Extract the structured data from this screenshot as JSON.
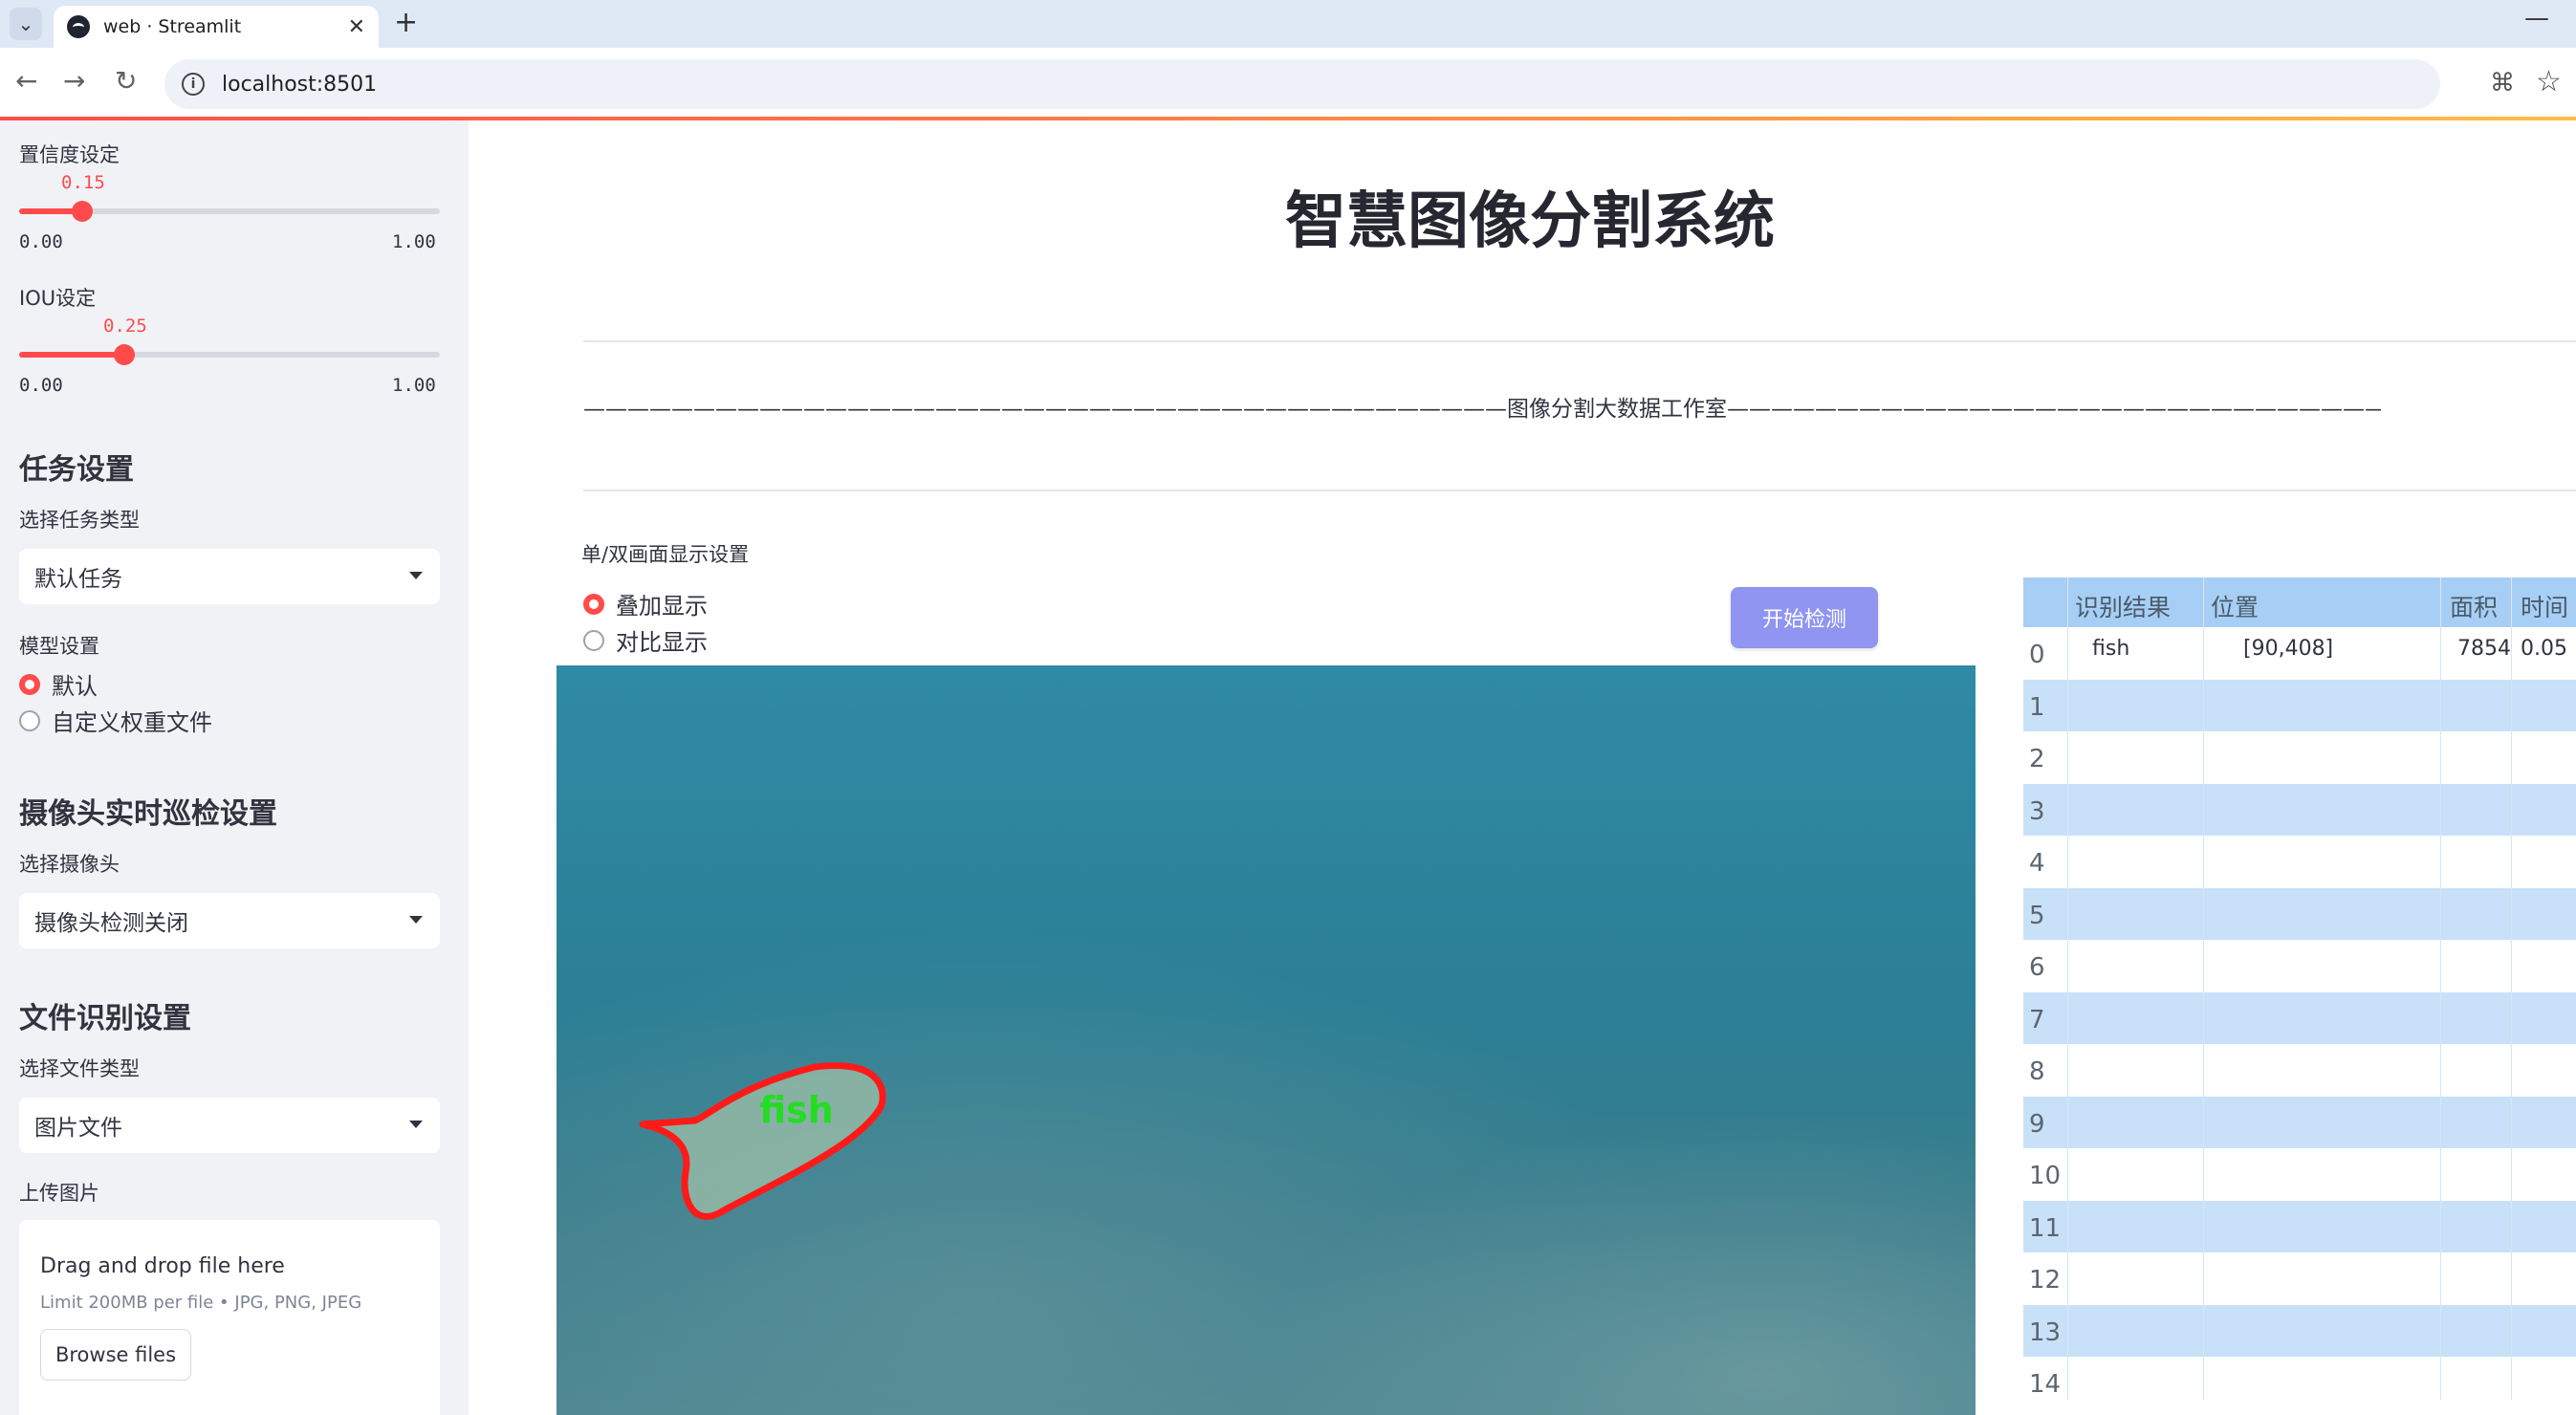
{
  "browser": {
    "tab_title": "web · Streamlit",
    "url": "localhost:8501"
  },
  "sidebar": {
    "confidence": {
      "label": "置信度设定",
      "value": "0.15",
      "value_fraction": 0.15,
      "min": "0.00",
      "max": "1.00"
    },
    "iou": {
      "label": "IOU设定",
      "value": "0.25",
      "value_fraction": 0.25,
      "min": "0.00",
      "max": "1.00"
    },
    "task_heading": "任务设置",
    "task_type_label": "选择任务类型",
    "task_type_value": "默认任务",
    "model_label": "模型设置",
    "model_options": [
      "默认",
      "自定义权重文件"
    ],
    "model_selected": 0,
    "camera_heading": "摄像头实时巡检设置",
    "camera_label": "选择摄像头",
    "camera_value": "摄像头检测关闭",
    "file_heading": "文件识别设置",
    "file_type_label": "选择文件类型",
    "file_type_value": "图片文件",
    "upload_label": "上传图片",
    "upload_title": "Drag and drop file here",
    "upload_limit": "Limit 200MB per file • JPG, PNG, JPEG",
    "browse_label": "Browse files"
  },
  "main": {
    "title": "智慧图像分割系统",
    "subtitle": "——————————————————————————————————————————图像分割大数据工作室——————————————————————————————————————————",
    "display_label": "单/双画面显示设置",
    "display_options": [
      "叠加显示",
      "对比显示"
    ],
    "display_selected": 0,
    "start_button": "开始检测",
    "detection_label": "fish"
  },
  "results_table": {
    "columns": [
      "识别结果",
      "位置",
      "面积",
      "时间"
    ],
    "row_indices": [
      "0",
      "1",
      "2",
      "3",
      "4",
      "5",
      "6",
      "7",
      "8",
      "9",
      "10",
      "11",
      "12",
      "13",
      "14"
    ],
    "rows": [
      {
        "result": "fish",
        "position": "[90,408]",
        "area": "7854",
        "time": "0.05"
      }
    ]
  },
  "colors": {
    "accent": "#ff4b4b",
    "button": "#8f95f0",
    "table_header": "#a7cff5",
    "table_stripe": "#c8e1f8",
    "sidebar_bg": "#f0f2f6",
    "mask_outline": "#ff1a1a",
    "mask_label": "#22dd22"
  }
}
